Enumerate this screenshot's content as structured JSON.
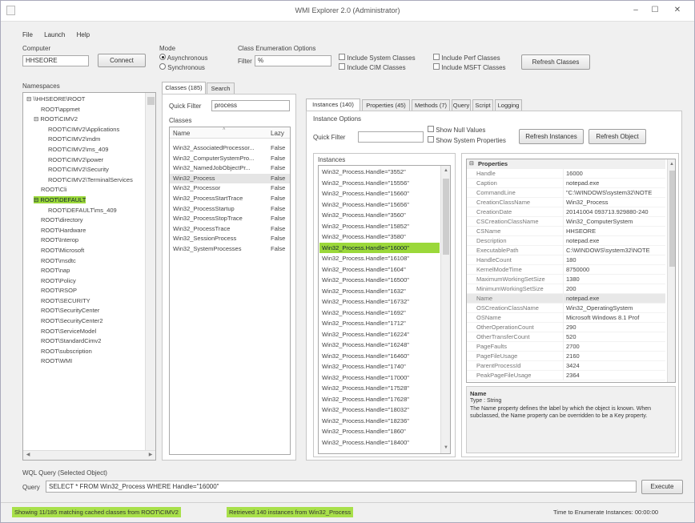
{
  "window": {
    "title": "WMI Explorer 2.0 (Administrator)",
    "minimize": "–",
    "maximize": "☐",
    "close": "✕"
  },
  "menu": [
    "File",
    "Launch",
    "Help"
  ],
  "computer": {
    "label": "Computer",
    "value": "HHSEORE",
    "connect": "Connect"
  },
  "mode": {
    "label": "Mode",
    "options": [
      "Asynchronous",
      "Synchronous"
    ],
    "selected": "Asynchronous"
  },
  "class_enum": {
    "label": "Class Enumeration Options",
    "filter_label": "Filter",
    "filter_value": "%",
    "checks": [
      "Include System Classes",
      "Include CIM Classes",
      "Include Perf Classes",
      "Include MSFT Classes"
    ],
    "refresh": "Refresh Classes"
  },
  "namespaces": {
    "label": "Namespaces",
    "items": [
      {
        "t": "⊟ \\\\HHSEORE\\ROOT",
        "i": 0
      },
      {
        "t": "ROOT\\appmet",
        "i": 2
      },
      {
        "t": "⊟ ROOT\\CIMV2",
        "i": 1
      },
      {
        "t": "ROOT\\CIMV2\\Applications",
        "i": 3
      },
      {
        "t": "ROOT\\CIMV2\\mdm",
        "i": 3
      },
      {
        "t": "ROOT\\CIMV2\\ms_409",
        "i": 3
      },
      {
        "t": "ROOT\\CIMV2\\power",
        "i": 3
      },
      {
        "t": "ROOT\\CIMV2\\Security",
        "i": 3
      },
      {
        "t": "ROOT\\CIMV2\\TerminalServices",
        "i": 3
      },
      {
        "t": "ROOT\\Cli",
        "i": 2
      },
      {
        "t": "⊟ ROOT\\DEFAULT",
        "i": 1,
        "hl": true
      },
      {
        "t": "ROOT\\DEFAULT\\ms_409",
        "i": 3
      },
      {
        "t": "ROOT\\directory",
        "i": 2
      },
      {
        "t": "ROOT\\Hardware",
        "i": 2
      },
      {
        "t": "ROOT\\Interop",
        "i": 2
      },
      {
        "t": "ROOT\\Microsoft",
        "i": 2
      },
      {
        "t": "ROOT\\msdtc",
        "i": 2
      },
      {
        "t": "ROOT\\nap",
        "i": 2
      },
      {
        "t": "ROOT\\Policy",
        "i": 2
      },
      {
        "t": "ROOT\\RSOP",
        "i": 2
      },
      {
        "t": "ROOT\\SECURITY",
        "i": 2
      },
      {
        "t": "ROOT\\SecurityCenter",
        "i": 2
      },
      {
        "t": "ROOT\\SecurityCenter2",
        "i": 2
      },
      {
        "t": "ROOT\\ServiceModel",
        "i": 2
      },
      {
        "t": "ROOT\\StandardCimv2",
        "i": 2
      },
      {
        "t": "ROOT\\subscription",
        "i": 2
      },
      {
        "t": "ROOT\\WMI",
        "i": 2
      }
    ]
  },
  "classes_tabs": [
    "Classes (185)",
    "Search"
  ],
  "classes": {
    "quick_filter_label": "Quick Filter",
    "quick_filter_value": "process",
    "label": "Classes",
    "col_name": "Name",
    "col_lazy": "Lazy",
    "rows": [
      {
        "name": "Win32_AssociatedProcessor...",
        "lazy": "False"
      },
      {
        "name": "Win32_ComputerSystemPro...",
        "lazy": "False"
      },
      {
        "name": "Win32_NamedJobObjectPr...",
        "lazy": "False"
      },
      {
        "name": "Win32_Process",
        "lazy": "False",
        "sel": true
      },
      {
        "name": "Win32_Processor",
        "lazy": "False"
      },
      {
        "name": "Win32_ProcessStartTrace",
        "lazy": "False"
      },
      {
        "name": "Win32_ProcessStartup",
        "lazy": "False"
      },
      {
        "name": "Win32_ProcessStopTrace",
        "lazy": "False"
      },
      {
        "name": "Win32_ProcessTrace",
        "lazy": "False"
      },
      {
        "name": "Win32_SessionProcess",
        "lazy": "False"
      },
      {
        "name": "Win32_SystemProcesses",
        "lazy": "False"
      }
    ]
  },
  "right_tabs": [
    "Instances (140)",
    "Properties (45)",
    "Methods (7)",
    "Query",
    "Script",
    "Logging"
  ],
  "instance_opts": {
    "label": "Instance Options",
    "quick_filter_label": "Quick Filter",
    "checks": [
      "Show Null Values",
      "Show System Properties"
    ],
    "refresh_instances": "Refresh Instances",
    "refresh_object": "Refresh Object"
  },
  "instances": {
    "label": "Instances",
    "rows": [
      "Win32_Process.Handle=\"3552\"",
      "Win32_Process.Handle=\"15556\"",
      "Win32_Process.Handle=\"15660\"",
      "Win32_Process.Handle=\"15656\"",
      "Win32_Process.Handle=\"3560\"",
      "Win32_Process.Handle=\"15852\"",
      "Win32_Process.Handle=\"3580\"",
      "Win32_Process.Handle=\"16000\"",
      "Win32_Process.Handle=\"16108\"",
      "Win32_Process.Handle=\"1604\"",
      "Win32_Process.Handle=\"16500\"",
      "Win32_Process.Handle=\"1632\"",
      "Win32_Process.Handle=\"16732\"",
      "Win32_Process.Handle=\"1692\"",
      "Win32_Process.Handle=\"1712\"",
      "Win32_Process.Handle=\"16224\"",
      "Win32_Process.Handle=\"16248\"",
      "Win32_Process.Handle=\"16460\"",
      "Win32_Process.Handle=\"1740\"",
      "Win32_Process.Handle=\"17000\"",
      "Win32_Process.Handle=\"17528\"",
      "Win32_Process.Handle=\"17628\"",
      "Win32_Process.Handle=\"18032\"",
      "Win32_Process.Handle=\"18236\"",
      "Win32_Process.Handle=\"1860\"",
      "Win32_Process.Handle=\"18400\""
    ],
    "selected_index": 7
  },
  "properties": {
    "header": "Properties",
    "rows": [
      [
        "Handle",
        "16000"
      ],
      [
        "Caption",
        "notepad.exe"
      ],
      [
        "CommandLine",
        "\"C:\\WINDOWS\\system32\\NOTE"
      ],
      [
        "CreationClassName",
        "Win32_Process"
      ],
      [
        "CreationDate",
        "20141004 093713.929880-240"
      ],
      [
        "CSCreationClassName",
        "Win32_ComputerSystem"
      ],
      [
        "CSName",
        "HHSEORE"
      ],
      [
        "Description",
        "notepad.exe"
      ],
      [
        "ExecutablePath",
        "C:\\WINDOWS\\system32\\NOTE"
      ],
      [
        "HandleCount",
        "180"
      ],
      [
        "KernelModeTime",
        "8750000"
      ],
      [
        "MaximumWorkingSetSize",
        "1380"
      ],
      [
        "MinimumWorkingSetSize",
        "200"
      ],
      [
        "Name",
        "notepad.exe"
      ],
      [
        "OSCreationClassName",
        "Win32_OperatingSystem"
      ],
      [
        "OSName",
        "Microsoft Windows 8.1 Prof"
      ],
      [
        "OtherOperationCount",
        "290"
      ],
      [
        "OtherTransferCount",
        "520"
      ],
      [
        "PageFaults",
        "2700"
      ],
      [
        "PageFileUsage",
        "2160"
      ],
      [
        "ParentProcessId",
        "3424"
      ],
      [
        "PeakPageFileUsage",
        "2364"
      ]
    ],
    "desc_title": "Name",
    "desc_type": "Type : String",
    "desc_text": "The Name property defines the label by which the object is known. When subclassed, the Name property can be overridden to be a Key property."
  },
  "wql": {
    "label": "WQL Query (Selected Object)",
    "query_label": "Query",
    "query_value": "SELECT * FROM Win32_Process WHERE Handle=\"16000\"",
    "execute": "Execute"
  },
  "status": {
    "left": "Showing 11/185 matching cached classes from ROOT\\CIMV2",
    "mid": "Retrieved 140 instances from Win32_Process",
    "right": "Time to Enumerate Instances: 00:00:00"
  },
  "colors": {
    "highlight": "#9bd83a",
    "status_green": "#a8e04a"
  }
}
